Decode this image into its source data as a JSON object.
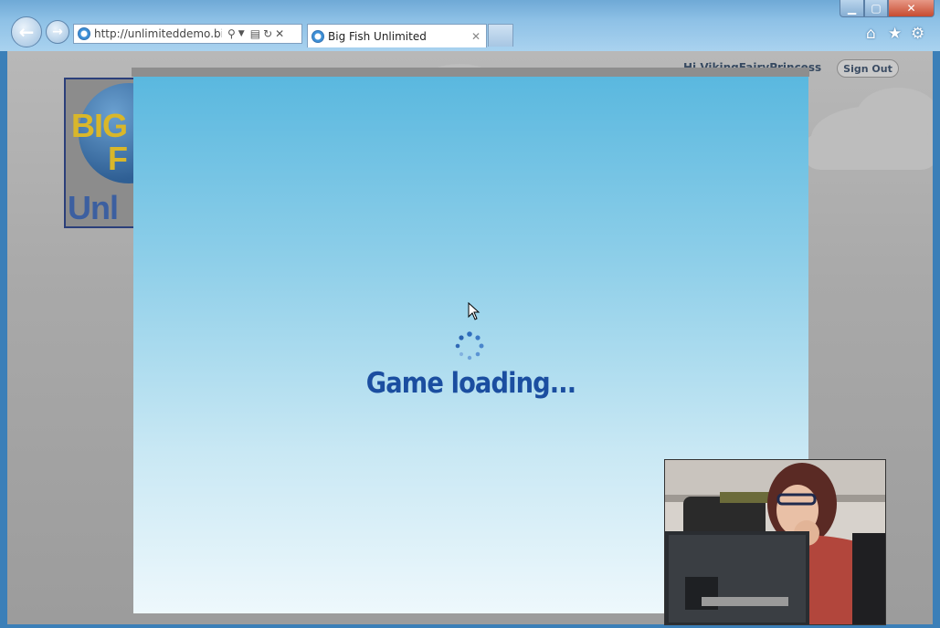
{
  "browser": {
    "url": "http://unlimiteddemo.bi...",
    "tab_title": "Big Fish Unlimited",
    "window_controls": {
      "minimize_icon": "minimize-icon",
      "maximize_icon": "maximize-icon",
      "close_icon": "close-icon"
    },
    "command_icons": [
      "home-icon",
      "star-icon",
      "gear-icon"
    ]
  },
  "header": {
    "logo_text": "Big Fish Unlimited",
    "greeting": "Hi VikingFairyPrincess",
    "signout_label": "Sign Out"
  },
  "game": {
    "loading_text": "Game loading..."
  },
  "colors": {
    "accent": "#1b4ea0",
    "sky_top": "#5ab8df",
    "sky_bottom": "#eef8fc"
  }
}
